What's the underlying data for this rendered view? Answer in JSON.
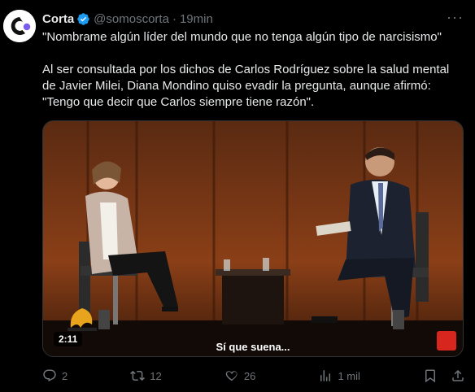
{
  "account": {
    "name": "Corta",
    "handle": "@somoscorta",
    "separator": "·",
    "time": "19min",
    "more": "···"
  },
  "tweet": {
    "text": "\"Nombrame algún líder del mundo que no tenga algún tipo de narcisismo\"\n\nAl ser consultada por los dichos de Carlos Rodríguez sobre la salud mental de Javier Milei, Diana Mondino quiso evadir la pregunta, aunque afirmó: \"Tengo que decir que Carlos siempre tiene razón\"."
  },
  "video": {
    "timestamp": "2:11",
    "subtitle": "Sí que suena..."
  },
  "actions": {
    "replies": "2",
    "retweets": "12",
    "likes": "26",
    "views": "1 mil"
  },
  "colors": {
    "accent": "#1d9bf0",
    "muted": "#71767b",
    "text": "#e7e9ea",
    "background": "#000000"
  },
  "icons": [
    "corta-logo-icon",
    "verified-badge-icon",
    "more-icon",
    "reply-icon",
    "retweet-icon",
    "like-icon",
    "views-icon",
    "bookmark-icon",
    "share-icon"
  ]
}
